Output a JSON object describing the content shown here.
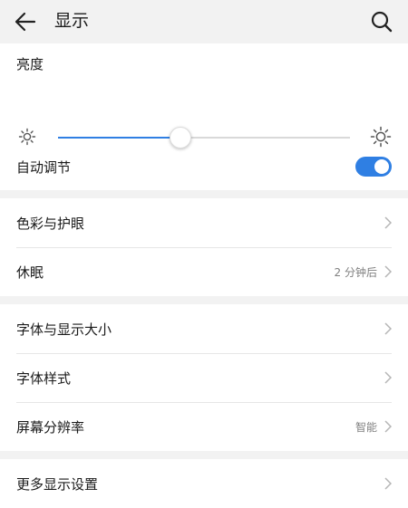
{
  "header": {
    "title": "显示",
    "back_icon": "back-arrow-icon",
    "search_icon": "search-icon"
  },
  "brightness": {
    "label": "亮度",
    "level": 0.42,
    "accent_color": "#2f7fe3"
  },
  "auto_adjust": {
    "label": "自动调节",
    "enabled": true
  },
  "group1": {
    "items": [
      {
        "label": "色彩与护眼",
        "value": ""
      },
      {
        "label": "休眠",
        "value": "2 分钟后"
      }
    ]
  },
  "group2": {
    "items": [
      {
        "label": "字体与显示大小",
        "value": ""
      },
      {
        "label": "字体样式",
        "value": ""
      },
      {
        "label": "屏幕分辨率",
        "value": "智能"
      }
    ]
  },
  "group3": {
    "items": [
      {
        "label": "更多显示设置",
        "value": ""
      }
    ]
  }
}
